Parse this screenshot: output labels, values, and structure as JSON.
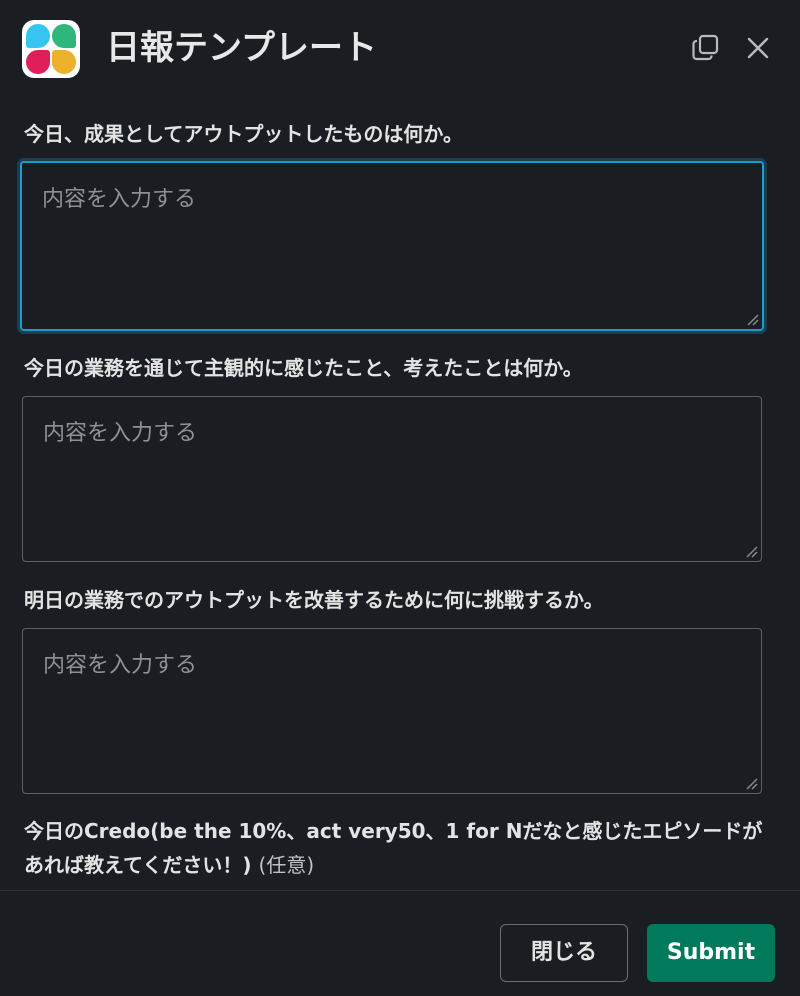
{
  "header": {
    "app_icon": "slack-app-icon",
    "title": "日報テンプレート",
    "copy_icon": "copy-icon",
    "close_icon": "close-icon"
  },
  "form": {
    "q1_label": "今日、成果としてアウトプットしたものは何か。",
    "q1_placeholder": "内容を入力する",
    "q2_label": "今日の業務を通じて主観的に感じたこと、考えたことは何か。",
    "q2_placeholder": "内容を入力する",
    "q3_label": "明日の業務でのアウトプットを改善するために何に挑戦するか。",
    "q3_placeholder": "内容を入力する",
    "q4_label": "今日のCredo(be the 10%、act very50、1 for Nだなと感じたエピソードがあれば教えてください！)",
    "q4_optional": "(任意)"
  },
  "footer": {
    "close_label": "閉じる",
    "submit_label": "Submit"
  },
  "colors": {
    "background": "#1a1d21",
    "focus": "#1d9bd1",
    "submit": "#007a5a"
  }
}
